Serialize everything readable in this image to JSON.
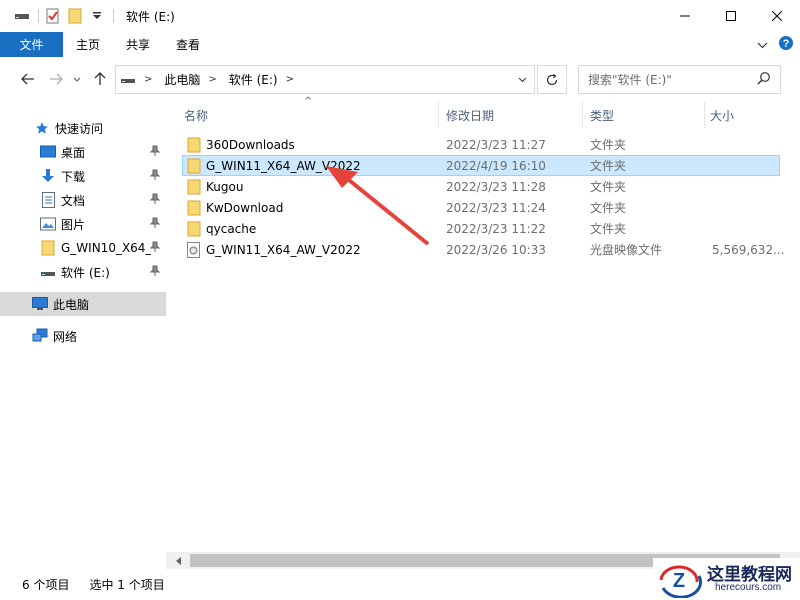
{
  "window": {
    "title": "软件 (E:)"
  },
  "ribbon": {
    "tabs": [
      "文件",
      "主页",
      "共享",
      "查看"
    ]
  },
  "address": {
    "path": [
      "此电脑",
      "软件 (E:)"
    ]
  },
  "search": {
    "placeholder": "搜索\"软件 (E:)\""
  },
  "sidebar": {
    "items": [
      {
        "label": "快速访问",
        "icon": "star-icon"
      },
      {
        "label": "桌面",
        "icon": "desktop-icon",
        "pinned": true
      },
      {
        "label": "下载",
        "icon": "download-icon",
        "pinned": true
      },
      {
        "label": "文档",
        "icon": "document-icon",
        "pinned": true
      },
      {
        "label": "图片",
        "icon": "picture-icon",
        "pinned": true
      },
      {
        "label": "G_WIN10_X64_",
        "icon": "folder-icon",
        "pinned": true
      },
      {
        "label": "软件 (E:)",
        "icon": "drive-icon",
        "pinned": true
      },
      {
        "label": "此电脑",
        "icon": "computer-icon",
        "active": true
      },
      {
        "label": "网络",
        "icon": "network-icon"
      }
    ]
  },
  "columns": {
    "name": "名称",
    "date": "修改日期",
    "type": "类型",
    "size": "大小"
  },
  "files": [
    {
      "name": "360Downloads",
      "date": "2022/3/23 11:27",
      "type": "文件夹",
      "size": "",
      "icon": "folder-icon"
    },
    {
      "name": "G_WIN11_X64_AW_V2022",
      "date": "2022/4/19 16:10",
      "type": "文件夹",
      "size": "",
      "icon": "folder-icon",
      "selected": true
    },
    {
      "name": "Kugou",
      "date": "2022/3/23 11:28",
      "type": "文件夹",
      "size": "",
      "icon": "folder-icon"
    },
    {
      "name": "KwDownload",
      "date": "2022/3/23 11:24",
      "type": "文件夹",
      "size": "",
      "icon": "folder-icon"
    },
    {
      "name": "qycache",
      "date": "2022/3/23 11:22",
      "type": "文件夹",
      "size": "",
      "icon": "folder-icon"
    },
    {
      "name": "G_WIN11_X64_AW_V2022",
      "date": "2022/3/26 10:33",
      "type": "光盘映像文件",
      "size": "5,569,632...",
      "icon": "disc-image-icon"
    }
  ],
  "status": {
    "count": "6 个项目",
    "selected": "选中 1 个项目"
  },
  "watermark": {
    "line1": "这里教程网",
    "line2": "herecours.com"
  },
  "colors": {
    "accent": "#1a6ec2",
    "selection": "#cce8ff",
    "folder": "#f8d775",
    "arrow": "#e8433a"
  }
}
